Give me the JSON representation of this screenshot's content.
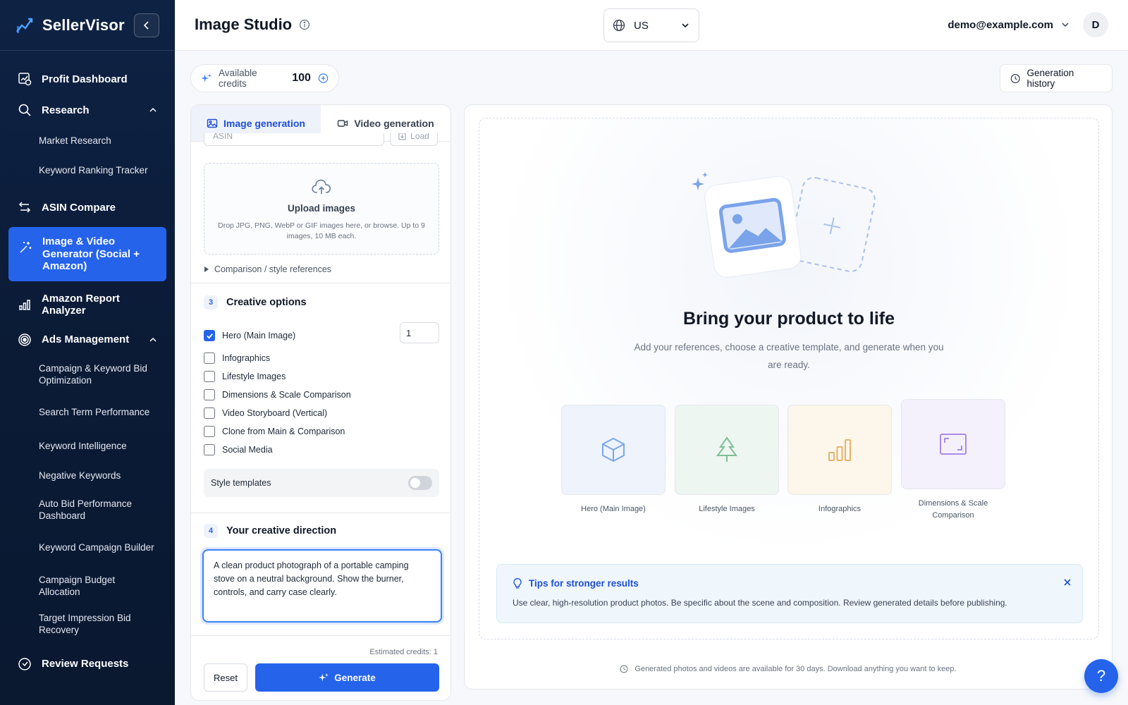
{
  "brand": {
    "name": "SellerVisor"
  },
  "sidebar": {
    "items": [
      {
        "label": "Profit Dashboard"
      },
      {
        "label": "Research",
        "children": [
          "Market Research",
          "Keyword Ranking Tracker"
        ]
      },
      {
        "label": "ASIN Compare"
      },
      {
        "label": "Image & Video Generator (Social + Amazon)",
        "active": true
      },
      {
        "label": "Amazon Report Analyzer"
      },
      {
        "label": "Ads Management",
        "children": [
          "Campaign & Keyword Bid Optimization",
          "Search Term Performance",
          "Keyword Intelligence",
          "Negative Keywords",
          "Auto Bid Performance Dashboard",
          "Keyword Campaign Builder",
          "Campaign Budget Allocation",
          "Target Impression Bid Recovery"
        ]
      },
      {
        "label": "Review Requests"
      }
    ]
  },
  "header": {
    "title": "Image Studio",
    "region": "US",
    "user_email": "demo@example.com",
    "avatar_initial": "D"
  },
  "credits": {
    "label": "Available credits",
    "value": "100"
  },
  "history_button": "Generation history",
  "left_panel": {
    "tabs": [
      {
        "label": "Image generation"
      },
      {
        "label": "Video generation"
      }
    ],
    "asin_placeholder": "ASIN",
    "load_label": "Load",
    "upload": {
      "title": "Upload images",
      "hint": "Drop JPG, PNG, WebP or GIF images here, or browse. Up to 9 images, 10 MB each."
    },
    "comparison_label": "Comparison / style references",
    "step3": {
      "num": "3",
      "title": "Creative options"
    },
    "options": [
      {
        "label": "Hero (Main Image)",
        "checked": true,
        "qty": "1"
      },
      {
        "label": "Infographics",
        "checked": false
      },
      {
        "label": "Lifestyle Images",
        "checked": false
      },
      {
        "label": "Dimensions & Scale Comparison",
        "checked": false
      },
      {
        "label": "Video Storyboard (Vertical)",
        "checked": false
      },
      {
        "label": "Clone from Main & Comparison",
        "checked": false
      },
      {
        "label": "Social Media",
        "checked": false
      }
    ],
    "style_templates": {
      "label": "Style templates",
      "enabled": false
    },
    "step4": {
      "num": "4",
      "title": "Your creative direction"
    },
    "direction_text": "A clean product photograph of a portable camping stove on a neutral background. Show the burner, controls, and carry case clearly.",
    "estimated": "Estimated credits: 1",
    "reset_label": "Reset",
    "generate_label": "Generate"
  },
  "right_panel": {
    "title": "Bring your product to life",
    "subtitle": "Add your references, choose a creative template, and generate when you are ready.",
    "templates": [
      {
        "label": "Hero (Main Image)",
        "icon": "box-icon",
        "color": "#7aa7ea"
      },
      {
        "label": "Lifestyle Images",
        "icon": "tree-icon",
        "color": "#7fbf98"
      },
      {
        "label": "Infographics",
        "icon": "bar-chart-icon",
        "color": "#e8b36a"
      },
      {
        "label": "Dimensions & Scale Comparison",
        "icon": "frame-icon",
        "color": "#a98ce6"
      }
    ],
    "tips": {
      "title": "Tips for stronger results",
      "body": "Use clear, high-resolution product photos. Be specific about the scene and composition. Review generated details before publishing."
    },
    "footer": "Generated photos and videos are available for 30 days. Download anything you want to keep."
  },
  "help_label": "?",
  "colors": {
    "accent": "#2563eb",
    "sidebar_bg": "#0e2244"
  }
}
